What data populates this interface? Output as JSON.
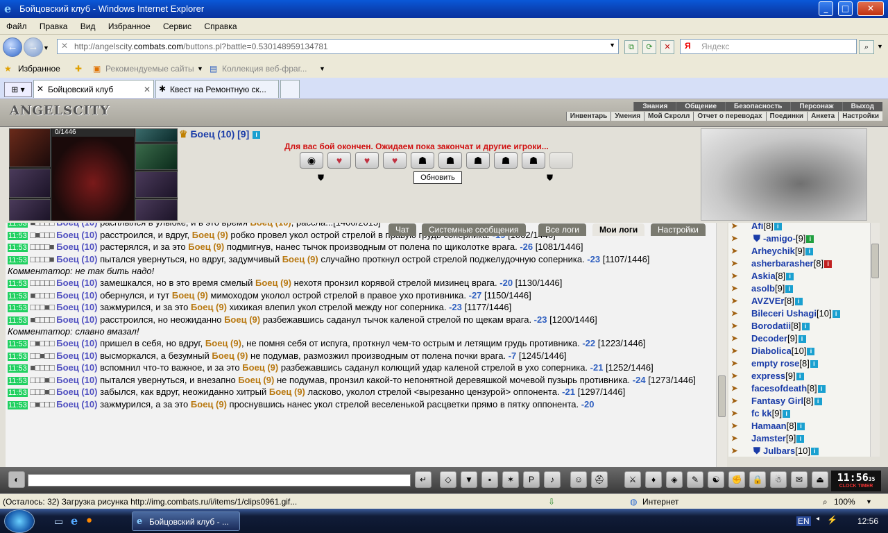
{
  "window": {
    "title": "Бойцовский клуб - Windows Internet Explorer"
  },
  "menu": [
    "Файл",
    "Правка",
    "Вид",
    "Избранное",
    "Сервис",
    "Справка"
  ],
  "address": {
    "url_prefix": "http://angelscity.",
    "url_domain": "combats.com",
    "url_rest": "/buttons.pl?battle=0.530148959134781",
    "search_placeholder": "Яндекс"
  },
  "favbar": {
    "favorites": "Избранное",
    "recommended": "Рекомендуемые сайты",
    "collection": "Коллекция веб-фраг..."
  },
  "tabs": [
    {
      "label": "Бойцовский клуб"
    },
    {
      "label": "Квест на Ремонтную ск..."
    }
  ],
  "game": {
    "logo": "ANGELSCITY",
    "menu_top": [
      "Знания",
      "Общение",
      "Безопасность",
      "Персонаж",
      "Выход"
    ],
    "menu_sub": [
      "Инвентарь",
      "Умения",
      "Мой Скролл",
      "Отчет о переводах",
      "Поединки",
      "Анкета",
      "Настройки"
    ],
    "hp": "0/1446",
    "fighter_name": "Боец (10) [9]",
    "battle_message": "Для вас бой окончен. Ожидаем пока закончат и другие игроки...",
    "refresh_button": "Обновить",
    "log_tabs": [
      "Чат",
      "Системные сообщения",
      "Все логи",
      "Мои логи",
      "Настройки"
    ]
  },
  "log": [
    {
      "time": "11:53",
      "sq": "■□□□□",
      "a": "Боец (10)",
      "t1": " расплылся в улыбке, и в это время ",
      "b": "Боец (10)",
      "t2": ", рассла...",
      "dmg": "",
      "hp": "[1400/2015]"
    },
    {
      "time": "11:53",
      "sq": "□■□□□",
      "a": "Боец (10)",
      "t1": " расстроился, и вдруг, ",
      "b": "Боец (9)",
      "t2": " робко провел укол острой стрелой в правую грудь соперника. ",
      "dmg": "-19",
      "hp": " [1062/1446]"
    },
    {
      "time": "11:53",
      "sq": "□□□□■",
      "a": "Боец (10)",
      "t1": " растерялся, и за это ",
      "b": "Боец (9)",
      "t2": " подмигнув, нанес тычок производным от полена по щиколотке врага. ",
      "dmg": "-26",
      "hp": " [1081/1446]"
    },
    {
      "time": "11:53",
      "sq": "□□□□■",
      "a": "Боец (10)",
      "t1": " пытался увернуться, но вдруг, задумчивый ",
      "b": "Боец (9)",
      "t2": " случайно проткнул острой стрелой поджелудочную соперника. ",
      "dmg": "-23",
      "hp": " [1107/1446]"
    },
    {
      "comment": "Комментатор: не так бить надо!"
    },
    {
      "time": "11:53",
      "sq": "□□□□□",
      "a": "Боец (10)",
      "t1": " замешкался, но в это время смелый ",
      "b": "Боец (9)",
      "t2": " нехотя пронзил корявой стрелой мизинец врага. ",
      "dmg": "-20",
      "hp": " [1130/1446]"
    },
    {
      "time": "11:53",
      "sq": "■□□□□",
      "a": "Боец (10)",
      "t1": " обернулся, и тут ",
      "b": "Боец (9)",
      "t2": " мимоходом уколол острой стрелой в правое ухо противника. ",
      "dmg": "-27",
      "hp": " [1150/1446]"
    },
    {
      "time": "11:53",
      "sq": "□□□■□",
      "a": "Боец (10)",
      "t1": " зажмурился, и за это ",
      "b": "Боец (9)",
      "t2": " хихикая влепил укол стрелой между ног соперника. ",
      "dmg": "-23",
      "hp": " [1177/1446]"
    },
    {
      "time": "11:53",
      "sq": "■□□□□",
      "a": "Боец (10)",
      "t1": " расстроился, но неожиданно ",
      "b": "Боец (9)",
      "t2": " разбежавшись саданул тычок каленой стрелой по щекам врага. ",
      "dmg": "-23",
      "hp": " [1200/1446]"
    },
    {
      "comment": "Комментатор: славно вмазал!"
    },
    {
      "time": "11:53",
      "sq": "□■□□□",
      "a": "Боец (10)",
      "t1": " пришел в себя, но вдруг, ",
      "b": "Боец (9)",
      "t2": ", не помня себя от испуга, проткнул чем-то острым и летящим грудь противника. ",
      "dmg": "-22",
      "hp": " [1223/1446]"
    },
    {
      "time": "11:53",
      "sq": "□□■□□",
      "a": "Боец (10)",
      "t1": " высморкался, а безумный ",
      "b": "Боец (9)",
      "t2": " не подумав, размозжил производным от полена почки врага. ",
      "dmg": "-7",
      "hp": " [1245/1446]"
    },
    {
      "time": "11:53",
      "sq": "■□□□□",
      "a": "Боец (10)",
      "t1": " вспомнил что-то важное, и за это ",
      "b": "Боец (9)",
      "t2": " разбежавшись саданул колющий удар каленой стрелой в ухо соперника. ",
      "dmg": "-21",
      "hp": " [1252/1446]"
    },
    {
      "time": "11:53",
      "sq": "□□□■□",
      "a": "Боец (10)",
      "t1": " пытался увернуться, и внезапно ",
      "b": "Боец (9)",
      "t2": " не подумав, пронзил какой-то непонятной деревяшкой мочевой пузырь противника. ",
      "dmg": "-24",
      "hp": " [1273/1446]"
    },
    {
      "time": "11:53",
      "sq": "□□□■□",
      "a": "Боец (10)",
      "t1": " забылся, как вдруг, неожиданно хитрый ",
      "b": "Боец (9)",
      "t2": " ласково, уколол стрелой <вырезанно цензурой> оппонента. ",
      "dmg": "-21",
      "hp": " [1297/1446]"
    },
    {
      "time": "11:53",
      "sq": "□■□□□",
      "a": "Боец (10)",
      "t1": " зажмурился, а за это ",
      "b": "Боец (9)",
      "t2": " проснувшись нанес укол стрелой веселенькой расцветки прямо в пятку оппонента. ",
      "dmg": "-20",
      "hp": ""
    }
  ],
  "users": [
    {
      "name": "Afi",
      "lv": "[8]",
      "inf": "i",
      "ind": 0
    },
    {
      "name": "-amigo-",
      "lv": "[9]",
      "inf": "i",
      "ind": 1,
      "g": true
    },
    {
      "name": "Arheychik",
      "lv": "[9]",
      "inf": "i",
      "ind": 0
    },
    {
      "name": "asherbarasher",
      "lv": "[8]",
      "inf": "i",
      "ind": 0,
      "r": true
    },
    {
      "name": "Askia",
      "lv": "[8]",
      "inf": "i",
      "ind": 0
    },
    {
      "name": "asolb",
      "lv": "[9]",
      "inf": "i",
      "ind": 0
    },
    {
      "name": "AVZVEr",
      "lv": "[8]",
      "inf": "i",
      "ind": 0
    },
    {
      "name": "Bileceri Ushagi",
      "lv": "[10]",
      "inf": "i",
      "ind": 0
    },
    {
      "name": "Borodatii",
      "lv": "[8]",
      "inf": "i",
      "ind": 0
    },
    {
      "name": "Decoder",
      "lv": "[9]",
      "inf": "i",
      "ind": 0
    },
    {
      "name": "Diabolica",
      "lv": "[10]",
      "inf": "i",
      "ind": 0
    },
    {
      "name": "empty rose",
      "lv": "[8]",
      "inf": "i",
      "ind": 0
    },
    {
      "name": "express",
      "lv": "[9]",
      "inf": "i",
      "ind": 0
    },
    {
      "name": "facesofdeath",
      "lv": "[8]",
      "inf": "i",
      "ind": 0
    },
    {
      "name": "Fantasy Girl",
      "lv": "[8]",
      "inf": "i",
      "ind": 0
    },
    {
      "name": "fc kk",
      "lv": "[9]",
      "inf": "i",
      "ind": 0
    },
    {
      "name": "Hamaan",
      "lv": "[8]",
      "inf": "i",
      "ind": 0
    },
    {
      "name": "Jamster",
      "lv": "[9]",
      "inf": "i",
      "ind": 0
    },
    {
      "name": "Julbars",
      "lv": "[10]",
      "inf": "i",
      "ind": 1
    }
  ],
  "clock": {
    "time": "11:56",
    "sec": "35",
    "label": "CLOCK TIMER"
  },
  "status": {
    "loading": "(Осталось: 32) Загрузка рисунка http://img.combats.ru/i/items/1/clips0961.gif...",
    "zone": "Интернет",
    "zoom": "100%"
  },
  "taskbar": {
    "item": "Бойцовский клуб - ...",
    "lang": "EN",
    "time": "12:56"
  }
}
